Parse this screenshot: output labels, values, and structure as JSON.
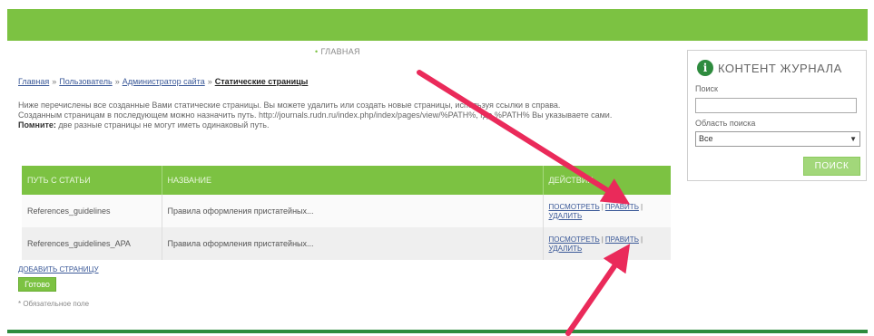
{
  "nav": {
    "home": "ГЛАВНАЯ"
  },
  "breadcrumb": {
    "items": [
      "Главная",
      "Пользователь",
      "Администратор сайта"
    ],
    "separator": "»",
    "current": "Статические страницы"
  },
  "info": {
    "line1": "Ниже перечислены все созданные Вами статические страницы. Вы можете удалить или создать новые страницы, используя ссылки в справа.",
    "line2": "Созданным страницам в последующем можно назначить путь. http://journals.rudn.ru/index.php/index/pages/view/%PATH%, где %PATH% Вы указываете сами.",
    "note_bold": "Помните:",
    "note_text": "две разные страницы не могут иметь одинаковый путь."
  },
  "table": {
    "headers": [
      "ПУТЬ С СТАТЬИ",
      "НАЗВАНИЕ",
      "ДЕЙСТВИЯ"
    ],
    "rows": [
      {
        "path": "References_guidelines",
        "title": "Правила оформления пристатейных...",
        "view": "ПОСМОТРЕТЬ",
        "edit": "ПРАВИТЬ",
        "delete": "УДАЛИТЬ"
      },
      {
        "path": "References_guidelines_APA",
        "title": "Правила оформления пристатейных...",
        "view": "ПОСМОТРЕТЬ",
        "edit": "ПРАВИТЬ",
        "delete": "УДАЛИТЬ"
      }
    ]
  },
  "add_page": "ДОБАВИТЬ СТРАНИЦУ",
  "ready_button": "Готово",
  "required_note": "* Обязательное поле",
  "sidebar": {
    "title": "КОНТЕНТ ЖУРНАЛА",
    "search_label": "Поиск",
    "search_value": "",
    "scope_label": "Область поиска",
    "scope_value": "Все",
    "search_button": "ПОИСК"
  },
  "colors": {
    "accent": "#7cc242",
    "arrow": "#ea2a5a",
    "link": "#3b5998"
  }
}
